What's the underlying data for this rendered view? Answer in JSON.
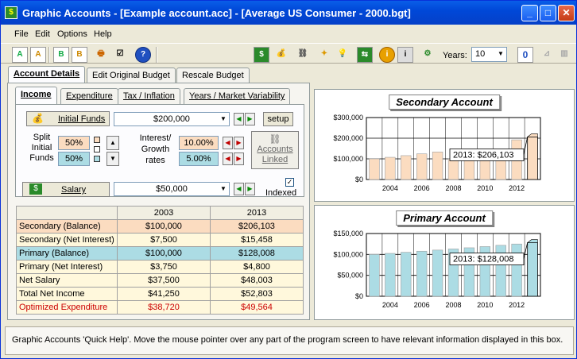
{
  "window": {
    "title": "Graphic Accounts - [Example account.acc] - [Average US Consumer - 2000.bgt]"
  },
  "menu": [
    "File",
    "Edit",
    "Options",
    "Help"
  ],
  "toolbar": {
    "years_label": "Years:",
    "years_value": "10",
    "zero_button": "0",
    "left_icons": [
      "account-details-icon",
      "analysis-icon",
      "budget-icon",
      "budget-edit-icon",
      "print-icon",
      "checklist-icon",
      "help-icon"
    ],
    "right_icons": [
      "money-icon",
      "money-bag-icon",
      "link-icon",
      "lightbulb-icon",
      "idea-icon",
      "refresh-money-icon",
      "info-icon",
      "info2-icon",
      "settings-icon"
    ]
  },
  "tabs": [
    "Account Details",
    "Edit Original Budget",
    "Rescale Budget"
  ],
  "subtabs": [
    "Income",
    "Expenditure",
    "Tax / Inflation",
    "Years / Market Variability"
  ],
  "income": {
    "initial_funds_label": "Initial Funds",
    "initial_funds_value": "$200,000",
    "setup_button": "setup",
    "split_label": "Split Initial Funds",
    "split_secondary": "50%",
    "split_primary": "50%",
    "rates_label": "Interest/ Growth rates",
    "rate_secondary": "10.00%",
    "rate_primary": "5.00%",
    "accounts_linked": "Accounts Linked",
    "salary_label": "Salary",
    "salary_value": "$50,000",
    "indexed_label": "Indexed",
    "indexed_checked": true
  },
  "table": {
    "columns": [
      "",
      "2003",
      "2013"
    ],
    "rows": [
      {
        "label": "Secondary (Balance)",
        "v2003": "$100,000",
        "v2013": "$206,103",
        "bg": "#fbdcc0",
        "color": "#000000"
      },
      {
        "label": "Secondary (Net Interest)",
        "v2003": "$7,500",
        "v2013": "$15,458",
        "bg": "#fff8dc",
        "color": "#000000"
      },
      {
        "label": "Primary (Balance)",
        "v2003": "$100,000",
        "v2013": "$128,008",
        "bg": "#acdce4",
        "color": "#000000"
      },
      {
        "label": "Primary (Net Interest)",
        "v2003": "$3,750",
        "v2013": "$4,800",
        "bg": "#fff8dc",
        "color": "#000000"
      },
      {
        "label": "Net Salary",
        "v2003": "$37,500",
        "v2013": "$48,003",
        "bg": "#fff8dc",
        "color": "#000000"
      },
      {
        "label": "Total Net Income",
        "v2003": "$41,250",
        "v2013": "$52,803",
        "bg": "#fff8dc",
        "color": "#000000"
      },
      {
        "label": "Optimized Expenditure",
        "v2003": "$38,720",
        "v2013": "$49,564",
        "bg": "#fff8dc",
        "color": "#cc0000"
      }
    ]
  },
  "chart_data": [
    {
      "type": "bar",
      "title": "Secondary Account",
      "x": [
        2003,
        2004,
        2005,
        2006,
        2007,
        2008,
        2009,
        2010,
        2011,
        2012,
        2013
      ],
      "xticks": [
        "2004",
        "2006",
        "2008",
        "2010",
        "2012"
      ],
      "values": [
        100000,
        107500,
        115600,
        124200,
        133500,
        100000,
        100000,
        100000,
        100000,
        192000,
        206103
      ],
      "ylim": [
        0,
        300000
      ],
      "yticks": [
        "$300,000",
        "$200,000",
        "$100,000",
        "$0"
      ],
      "ytick_values": [
        300000,
        200000,
        100000,
        0
      ],
      "annotation": "2013: $206,103",
      "bar_color": "#fbdcc0",
      "grid": true
    },
    {
      "type": "bar",
      "title": "Primary Account",
      "x": [
        2003,
        2004,
        2005,
        2006,
        2007,
        2008,
        2009,
        2010,
        2011,
        2012,
        2013
      ],
      "xticks": [
        "2004",
        "2006",
        "2008",
        "2010",
        "2012"
      ],
      "values": [
        100000,
        102500,
        105100,
        107700,
        110400,
        113100,
        115900,
        118800,
        121800,
        124900,
        128008
      ],
      "ylim": [
        0,
        150000
      ],
      "yticks": [
        "$150,000",
        "$100,000",
        "$50,000",
        "$0"
      ],
      "ytick_values": [
        150000,
        100000,
        50000,
        0
      ],
      "annotation": "2013: $128,008",
      "bar_color": "#acdce4",
      "grid": true
    }
  ],
  "status": "Graphic Accounts 'Quick Help'.  Move the mouse pointer over any part of the program screen to have relevant information displayed in this box."
}
